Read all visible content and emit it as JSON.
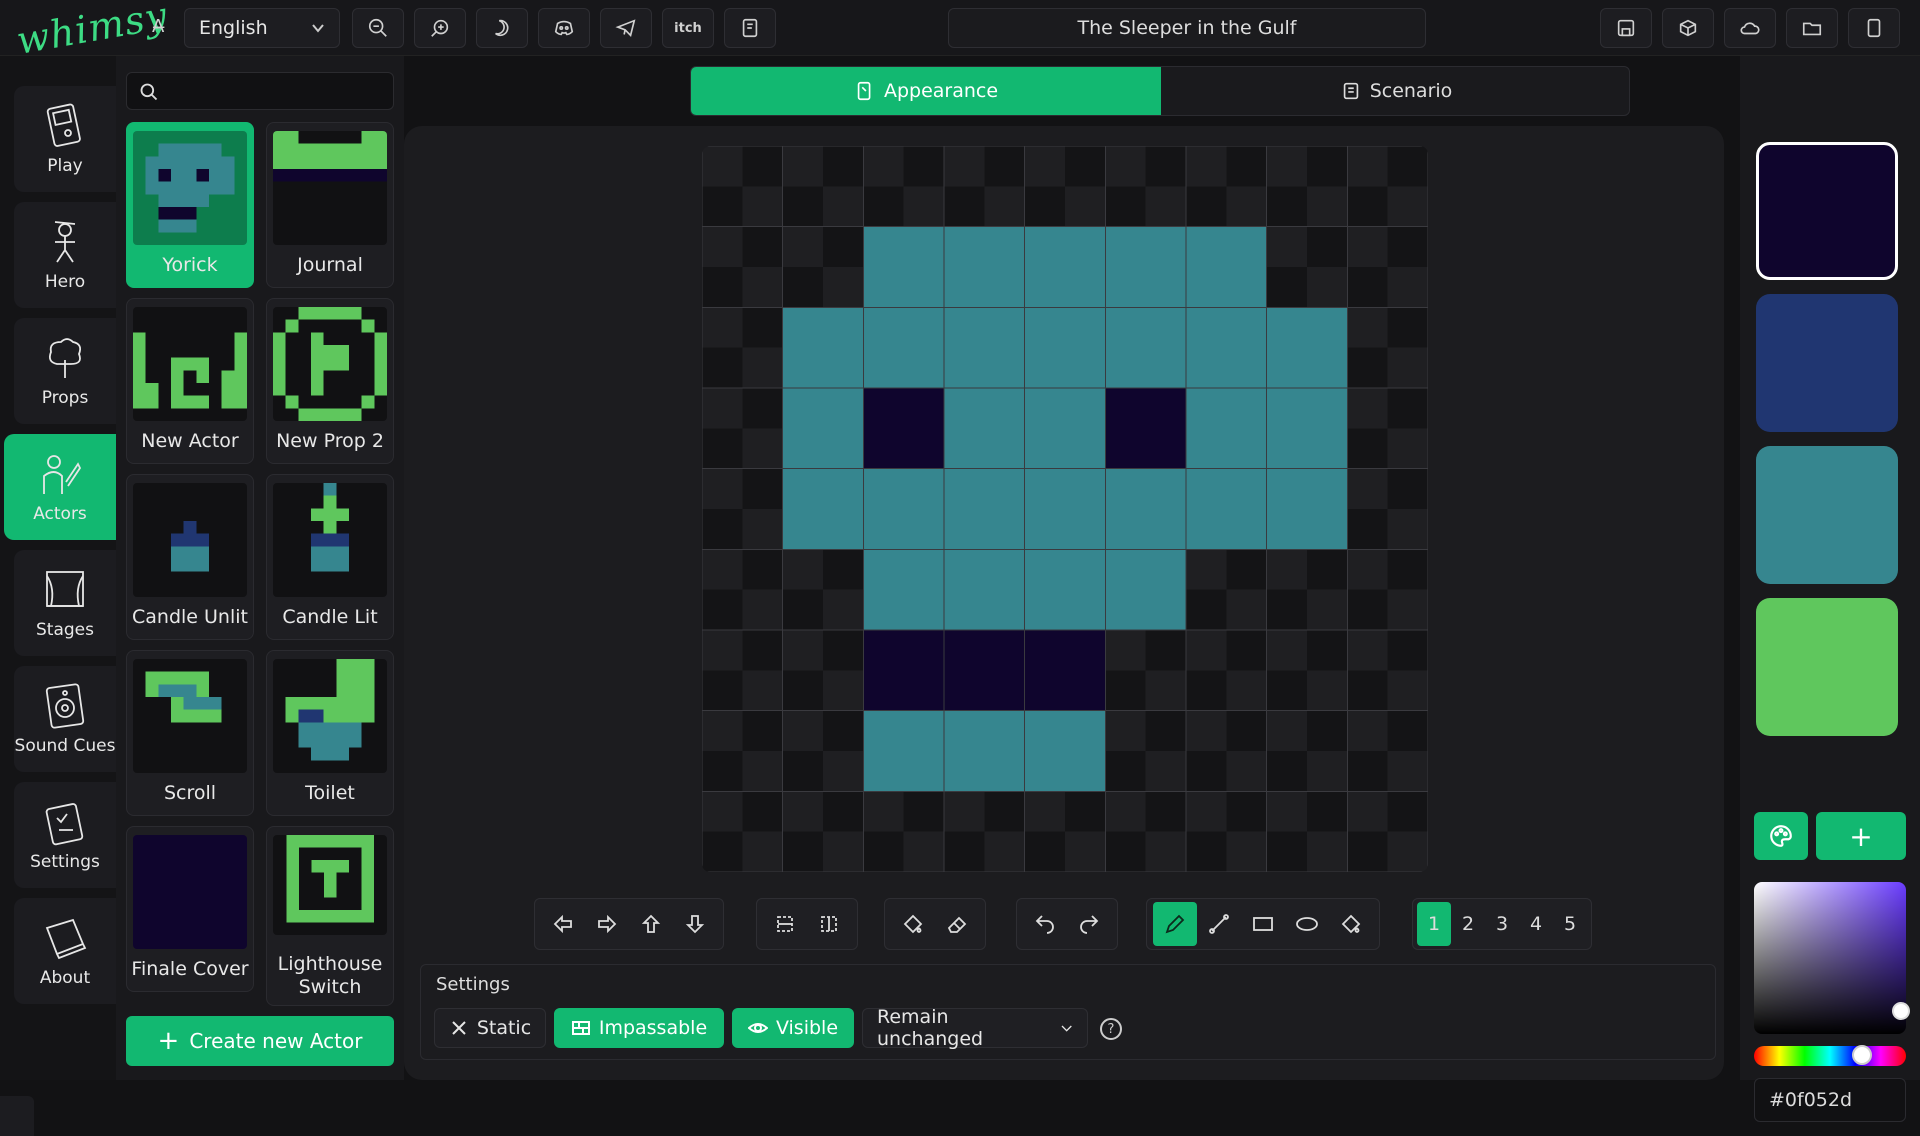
{
  "app": {
    "logo": "whimsy",
    "project_title": "The Sleeper in the Gulf"
  },
  "topbar": {
    "language_glyph": "A̶",
    "language": "English",
    "itch_label": "itch"
  },
  "sidenav": [
    {
      "id": "play",
      "label": "Play",
      "icon": "gameboy-icon"
    },
    {
      "id": "hero",
      "label": "Hero",
      "icon": "hero-icon"
    },
    {
      "id": "props",
      "label": "Props",
      "icon": "tree-icon"
    },
    {
      "id": "actors",
      "label": "Actors",
      "icon": "actor-icon",
      "active": true
    },
    {
      "id": "stages",
      "label": "Stages",
      "icon": "stage-icon"
    },
    {
      "id": "sound",
      "label": "Sound Cues",
      "icon": "speaker-icon"
    },
    {
      "id": "settings",
      "label": "Settings",
      "icon": "clipboard-icon"
    },
    {
      "id": "about",
      "label": "About",
      "icon": "book-icon"
    }
  ],
  "library": {
    "search_placeholder": "",
    "tiles": [
      {
        "label": "Yorick",
        "active": true
      },
      {
        "label": "Journal"
      },
      {
        "label": "New Actor"
      },
      {
        "label": "New Prop 2"
      },
      {
        "label": "Candle Unlit"
      },
      {
        "label": "Candle Lit"
      },
      {
        "label": "Scroll"
      },
      {
        "label": "Toilet"
      },
      {
        "label": "Finale Cover"
      },
      {
        "label": "Lighthouse Switch"
      }
    ],
    "create_label": "Create new Actor"
  },
  "tabs": [
    {
      "label": "Appearance",
      "active": true
    },
    {
      "label": "Scenario"
    }
  ],
  "frames": [
    "1",
    "2",
    "3",
    "4",
    "5"
  ],
  "active_frame": "1",
  "settings": {
    "title": "Settings",
    "static_label": "Static",
    "impassable_label": "Impassable",
    "visible_label": "Visible",
    "behavior_select": "Remain unchanged",
    "help": "?"
  },
  "palette": {
    "colors": [
      "#0f052d",
      "#203671",
      "#36868f",
      "#5fc75d"
    ],
    "selected": "#0f052d",
    "hex_value": "#0f052d"
  },
  "sprite": {
    "size": 9,
    "pixels": [
      "000000000",
      "002222200",
      "022222220",
      "021221220",
      "022222220",
      "002222000",
      "001110000",
      "002220000",
      "000000000"
    ]
  }
}
